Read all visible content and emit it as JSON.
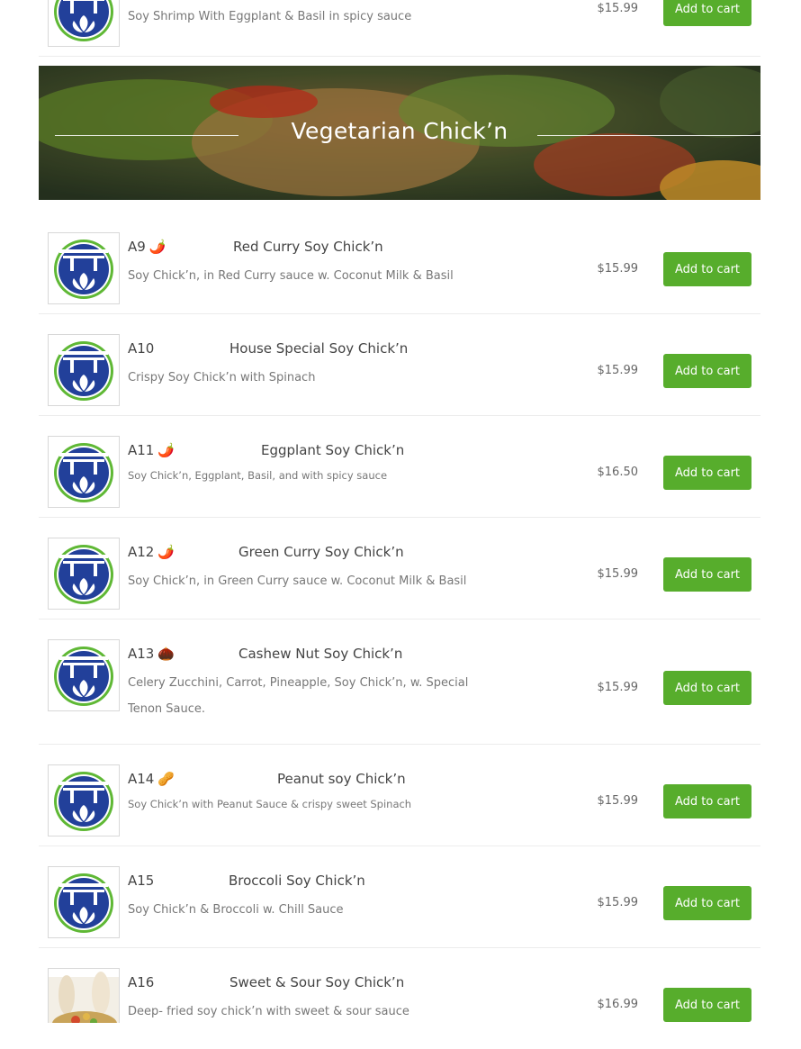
{
  "top_item": {
    "desc": "Soy Shrimp With Eggplant & Basil in spicy sauce",
    "price": "$15.99",
    "cart_label": "Add to cart"
  },
  "section": {
    "title": "Vegetarian Chick’n"
  },
  "items": [
    {
      "code": "A9",
      "emoji": "🌶️",
      "name": "Red Curry Soy Chick’n",
      "desc": "Soy Chick’n, in Red Curry sauce w. Coconut Milk & Basil",
      "price": "$15.99",
      "cart_label": "Add to cart"
    },
    {
      "code": "A10",
      "emoji": "",
      "name": "House Special Soy Chick’n",
      "desc": "Crispy Soy Chick’n with Spinach",
      "price": "$15.99",
      "cart_label": "Add to cart"
    },
    {
      "code": "A11",
      "emoji": "🌶️",
      "name": "Eggplant Soy Chick’n",
      "desc": "Soy Chick’n, Eggplant, Basil, and with spicy sauce",
      "price": "$16.50",
      "cart_label": "Add to cart"
    },
    {
      "code": "A12",
      "emoji": "🌶️",
      "name": "Green Curry Soy Chick’n",
      "desc": "Soy Chick’n, in Green Curry sauce w. Coconut Milk & Basil",
      "price": "$15.99",
      "cart_label": "Add to cart"
    },
    {
      "code": "A13",
      "emoji": "🌰",
      "name": "Cashew Nut Soy Chick’n",
      "desc": "Celery Zucchini, Carrot, Pineapple, Soy Chick’n, w. Special Tenon Sauce.",
      "price": "$15.99",
      "cart_label": "Add to cart"
    },
    {
      "code": "A14",
      "emoji": "🥜",
      "name": "Peanut soy Chick’n",
      "desc": "Soy Chick’n with Peanut Sauce & crispy sweet Spinach",
      "price": "$15.99",
      "cart_label": "Add to cart"
    },
    {
      "code": "A15",
      "emoji": "",
      "name": "Broccoli Soy Chick’n",
      "desc": "Soy Chick’n & Broccoli w. Chill Sauce",
      "price": "$15.99",
      "cart_label": "Add to cart"
    },
    {
      "code": "A16",
      "emoji": "",
      "name": "Sweet & Sour Soy Chick’n",
      "desc": "Deep- fried soy chick’n with sweet & sour sauce",
      "price": "$16.99",
      "cart_label": "Add to cart"
    }
  ],
  "colors": {
    "cart_button": "#57ad2c",
    "logo_blue": "#22409a",
    "logo_green": "#5fb835"
  }
}
